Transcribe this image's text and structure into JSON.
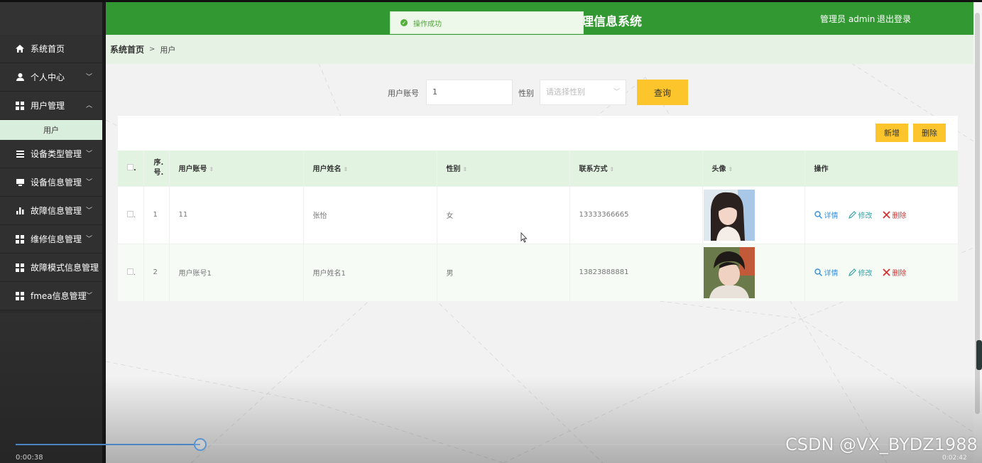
{
  "app": {
    "title": "理信息系统",
    "user": "管理员 admin",
    "logout": "退出登录"
  },
  "toast": {
    "message": "操作成功"
  },
  "sidebar": {
    "items": [
      {
        "label": "系统首页",
        "icon": "home-icon"
      },
      {
        "label": "个人中心",
        "icon": "person-icon",
        "chevron": "﹀"
      },
      {
        "label": "用户管理",
        "icon": "grid-icon",
        "chevron": "︿"
      },
      {
        "label": "设备类型管理",
        "icon": "list-icon",
        "chevron": "﹀"
      },
      {
        "label": "设备信息管理",
        "icon": "monitor-icon",
        "chevron": "﹀"
      },
      {
        "label": "故障信息管理",
        "icon": "bar-chart-icon",
        "chevron": "﹀"
      },
      {
        "label": "维修信息管理",
        "icon": "grid-icon",
        "chevron": "﹀"
      },
      {
        "label": "故障模式信息管理",
        "icon": "grid-icon"
      },
      {
        "label": "fmea信息管理",
        "icon": "grid-icon",
        "chevron": "﹀"
      }
    ],
    "sub_item": "用户"
  },
  "breadcrumb": {
    "home": "系统首页",
    "sep": ">",
    "current": "用户"
  },
  "search": {
    "account_label": "用户账号",
    "account_value": "1",
    "gender_label": "性别",
    "gender_placeholder": "请选择性别",
    "query_button": "查询"
  },
  "actions": {
    "add": "新增",
    "delete": "删除"
  },
  "table": {
    "columns": [
      "序号",
      "用户账号",
      "用户姓名",
      "性别",
      "联系方式",
      "头像",
      "操作"
    ],
    "index_header": [
      "序.",
      "号."
    ],
    "rows": [
      {
        "index": "1",
        "account": "11",
        "name": "张怡",
        "gender": "女",
        "phone": "13333366665",
        "avatar": "female"
      },
      {
        "index": "2",
        "account": "用户账号1",
        "name": "用户姓名1",
        "gender": "男",
        "phone": "13823888881",
        "avatar": "male"
      }
    ],
    "ops": {
      "detail": "详情",
      "edit": "修改",
      "delete": "删除"
    }
  },
  "video": {
    "elapsed": "0:00:38",
    "duration": "0:02:42",
    "progress": 0.24
  },
  "watermark": "CSDN @VX_BYDZ1988",
  "colors": {
    "header": "#329932",
    "accent": "#fbc52b",
    "sidebar": "#303030",
    "table_header": "#e2f4e1"
  }
}
